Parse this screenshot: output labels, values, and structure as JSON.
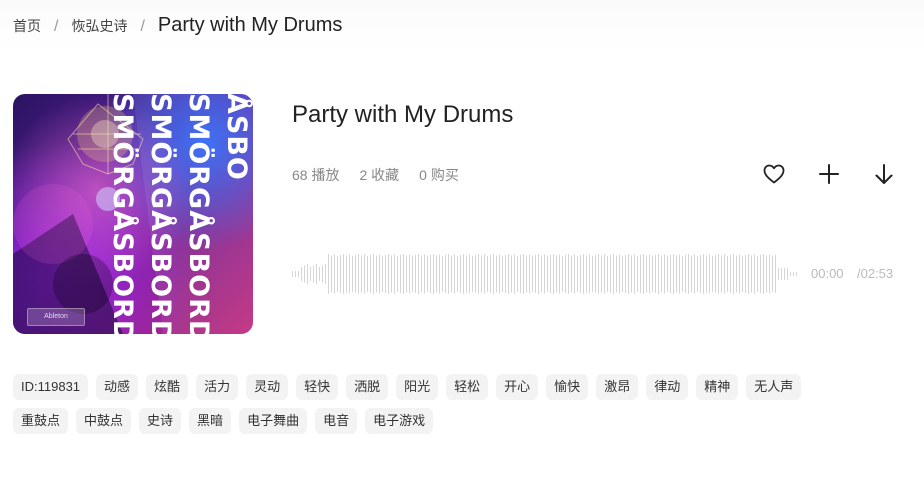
{
  "breadcrumb": {
    "home": "首页",
    "category": "恢弘史诗",
    "current": "Party with My Drums",
    "separator": "/"
  },
  "track": {
    "title": "Party with My Drums",
    "plays": "68 播放",
    "favorites": "2 收藏",
    "purchases": "0 购买",
    "cover_text": [
      "SMÖRGÅSBORD",
      "SMÖRGÅSBORD",
      "SMÖRGÅSBORD",
      "ÅSBO"
    ],
    "cover_badge": "Ableton"
  },
  "actions": [
    {
      "name": "favorite",
      "icon": "heart-icon"
    },
    {
      "name": "add",
      "icon": "plus-icon"
    },
    {
      "name": "download",
      "icon": "download-arrow-icon"
    }
  ],
  "player": {
    "current_time": "00:00",
    "total_time": "/02:53",
    "progress": 0
  },
  "tags_row1": [
    "ID:119831",
    "动感",
    "炫酷",
    "活力",
    "灵动",
    "轻快",
    "洒脱",
    "阳光",
    "轻松",
    "开心",
    "愉快",
    "激昂",
    "律动",
    "精神",
    "无人声"
  ],
  "tags_row2": [
    "重鼓点",
    "中鼓点",
    "史诗",
    "黑暗",
    "电子舞曲",
    "电音",
    "电子游戏"
  ],
  "colors": {
    "waveform": "#d6d6d6",
    "tag_bg": "#f3f3f3",
    "muted_text": "#888888"
  }
}
